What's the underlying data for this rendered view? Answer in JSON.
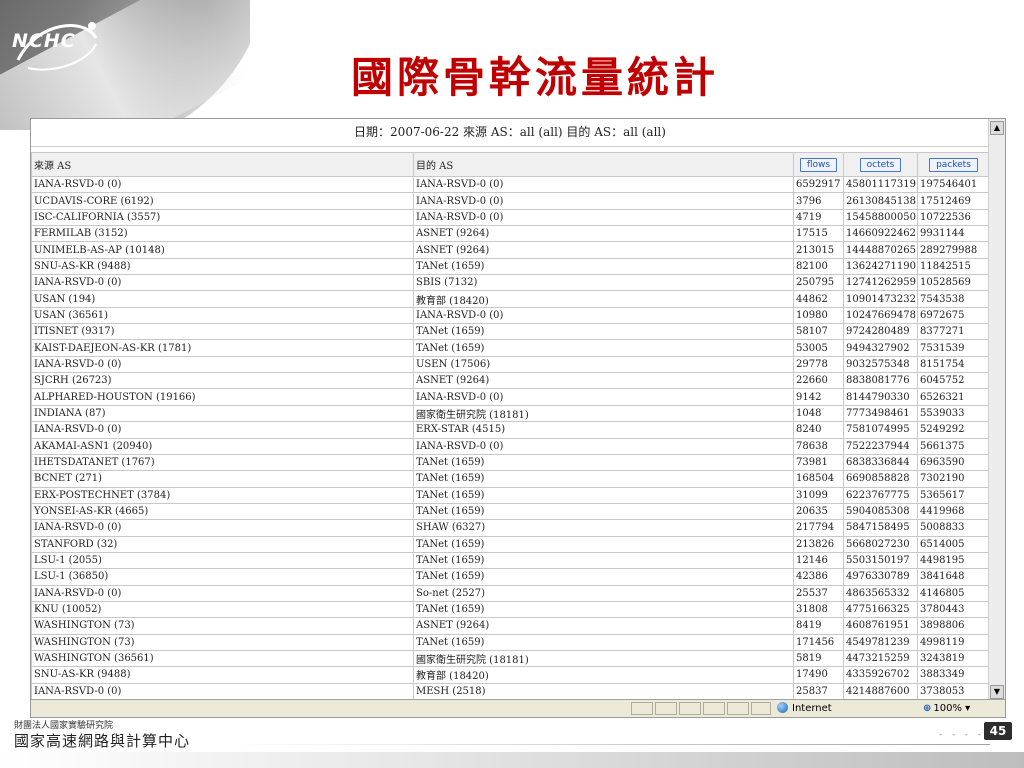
{
  "logo": {
    "text": "NCHC"
  },
  "slide": {
    "title": "國際骨幹流量統計",
    "page_number": "45"
  },
  "report": {
    "header": "日期：2007-06-22 來源 AS：all (all) 目的 AS：all (all)",
    "columns": {
      "src": "來源 AS",
      "dst": "目的 AS"
    },
    "sort_buttons": {
      "flows": "flows",
      "octets": "octets",
      "packets": "packets"
    },
    "rows": [
      [
        "IANA-RSVD-0 (0)",
        "IANA-RSVD-0 (0)",
        "6592917",
        "45801117319",
        "197546401"
      ],
      [
        "UCDAVIS-CORE (6192)",
        "IANA-RSVD-0 (0)",
        "3796",
        "26130845138",
        "17512469"
      ],
      [
        "ISC-CALIFORNIA (3557)",
        "IANA-RSVD-0 (0)",
        "4719",
        "15458800050",
        "10722536"
      ],
      [
        "FERMILAB (3152)",
        "ASNET (9264)",
        "17515",
        "14660922462",
        "9931144"
      ],
      [
        "UNIMELB-AS-AP (10148)",
        "ASNET (9264)",
        "213015",
        "14448870265",
        "289279988"
      ],
      [
        "SNU-AS-KR (9488)",
        "TANet (1659)",
        "82100",
        "13624271190",
        "11842515"
      ],
      [
        "IANA-RSVD-0 (0)",
        "SBIS (7132)",
        "250795",
        "12741262959",
        "10528569"
      ],
      [
        "USAN (194)",
        "教育部 (18420)",
        "44862",
        "10901473232",
        "7543538"
      ],
      [
        "USAN (36561)",
        "IANA-RSVD-0 (0)",
        "10980",
        "10247669478",
        "6972675"
      ],
      [
        "ITISNET (9317)",
        "TANet (1659)",
        "58107",
        "9724280489",
        "8377271"
      ],
      [
        "KAIST-DAEJEON-AS-KR (1781)",
        "TANet (1659)",
        "53005",
        "9494327902",
        "7531539"
      ],
      [
        "IANA-RSVD-0 (0)",
        "USEN (17506)",
        "29778",
        "9032575348",
        "8151754"
      ],
      [
        "SJCRH (26723)",
        "ASNET (9264)",
        "22660",
        "8838081776",
        "6045752"
      ],
      [
        "ALPHARED-HOUSTON (19166)",
        "IANA-RSVD-0 (0)",
        "9142",
        "8144790330",
        "6526321"
      ],
      [
        "INDIANA (87)",
        "國家衛生研究院 (18181)",
        "1048",
        "7773498461",
        "5539033"
      ],
      [
        "IANA-RSVD-0 (0)",
        "ERX-STAR (4515)",
        "8240",
        "7581074995",
        "5249292"
      ],
      [
        "AKAMAI-ASN1 (20940)",
        "IANA-RSVD-0 (0)",
        "78638",
        "7522237944",
        "5661375"
      ],
      [
        "IHETSDATANET (1767)",
        "TANet (1659)",
        "73981",
        "6838336844",
        "6963590"
      ],
      [
        "BCNET (271)",
        "TANet (1659)",
        "168504",
        "6690858828",
        "7302190"
      ],
      [
        "ERX-POSTECHNET (3784)",
        "TANet (1659)",
        "31099",
        "6223767775",
        "5365617"
      ],
      [
        "YONSEI-AS-KR (4665)",
        "TANet (1659)",
        "20635",
        "5904085308",
        "4419968"
      ],
      [
        "IANA-RSVD-0 (0)",
        "SHAW (6327)",
        "217794",
        "5847158495",
        "5008833"
      ],
      [
        "STANFORD (32)",
        "TANet (1659)",
        "213826",
        "5668027230",
        "6514005"
      ],
      [
        "LSU-1 (2055)",
        "TANet (1659)",
        "12146",
        "5503150197",
        "4498195"
      ],
      [
        "LSU-1 (36850)",
        "TANet (1659)",
        "42386",
        "4976330789",
        "3841648"
      ],
      [
        "IANA-RSVD-0 (0)",
        "So-net (2527)",
        "25537",
        "4863565332",
        "4146805"
      ],
      [
        "KNU (10052)",
        "TANet (1659)",
        "31808",
        "4775166325",
        "3780443"
      ],
      [
        "WASHINGTON (73)",
        "ASNET (9264)",
        "8419",
        "4608761951",
        "3898806"
      ],
      [
        "WASHINGTON (73)",
        "TANet (1659)",
        "171456",
        "4549781239",
        "4998119"
      ],
      [
        "WASHINGTON (36561)",
        "國家衛生研究院 (18181)",
        "5819",
        "4473215259",
        "3243819"
      ],
      [
        "SNU-AS-KR (9488)",
        "教育部 (18420)",
        "17490",
        "4335926702",
        "3883349"
      ],
      [
        "IANA-RSVD-0 (0)",
        "MESH (2518)",
        "25837",
        "4214887600",
        "3738053"
      ]
    ]
  },
  "statusbar": {
    "zone": "Internet",
    "zoom": "100%"
  },
  "footer": {
    "org_small": "財團法人國家實驗研究院",
    "org_big": "國家高速網路與計算中心"
  },
  "icons": {
    "logo": "nchc-logo",
    "zone": "globe-icon",
    "zoom": "zoom-icon",
    "scroll_up": "arrow-up-icon",
    "scroll_down": "arrow-down-icon"
  }
}
